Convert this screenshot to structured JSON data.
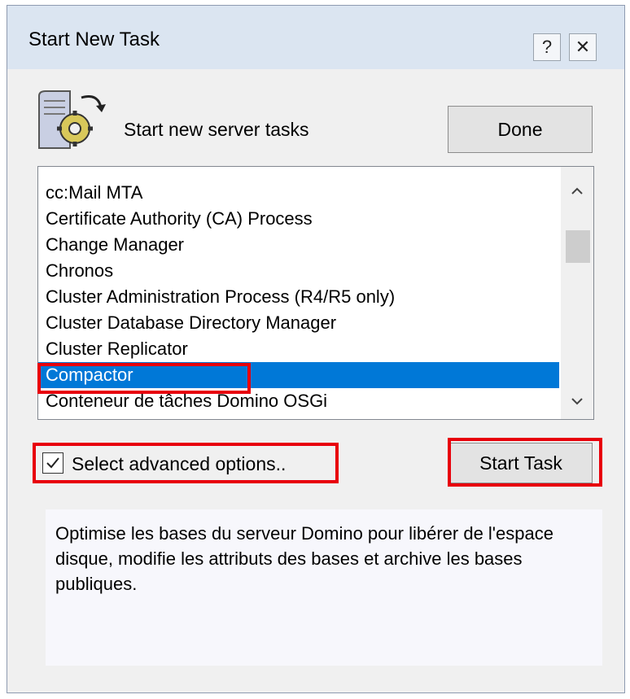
{
  "dialog": {
    "title": "Start New Task",
    "help_label": "?",
    "close_label": "✕",
    "header_text": "Start new server tasks",
    "done_label": "Done"
  },
  "tasks": {
    "items": [
      "cc:Mail MTA",
      "Certificate Authority (CA) Process",
      "Change Manager",
      "Chronos",
      "Cluster Administration Process (R4/R5 only)",
      "Cluster Database Directory Manager",
      "Cluster Replicator",
      "Compactor",
      "Conteneur de tâches Domino OSGi"
    ],
    "selected": "Compactor"
  },
  "options": {
    "advanced_label": "Select advanced options..",
    "advanced_checked": true,
    "start_label": "Start Task"
  },
  "description": "Optimise les bases du serveur Domino pour libérer de l'espace disque, modifie les attributs des bases et archive les bases publiques.",
  "colors": {
    "selection": "#0078d7",
    "highlight": "#e8000b",
    "titlebar": "#dbe5f1"
  },
  "icons": {
    "header": "server-task-gear-icon",
    "scroll_up": "chevron-up-icon",
    "scroll_down": "chevron-down-icon",
    "check": "checkmark-icon"
  }
}
